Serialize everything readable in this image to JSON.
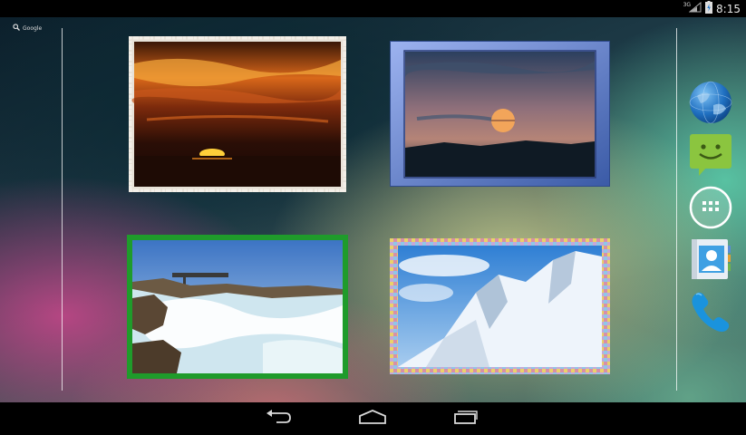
{
  "status_bar": {
    "network_label": "3G",
    "time": "8:15",
    "icons": [
      "signal-icon",
      "battery-icon"
    ]
  },
  "search": {
    "label": "Google",
    "icon": "search-icon"
  },
  "dock": {
    "items": [
      {
        "name": "browser",
        "icon": "globe-icon"
      },
      {
        "name": "messaging",
        "icon": "message-smiley-icon"
      },
      {
        "name": "all-apps",
        "icon": "app-drawer-icon"
      },
      {
        "name": "people",
        "icon": "contacts-icon"
      },
      {
        "name": "phone",
        "icon": "phone-icon"
      }
    ]
  },
  "widgets": [
    {
      "subject": "sunset-over-sea",
      "frame": "grunge-white"
    },
    {
      "subject": "moonrise-over-lake",
      "frame": "blue-bevel"
    },
    {
      "subject": "waves-on-rocks",
      "frame": "green"
    },
    {
      "subject": "snowy-mountain",
      "frame": "colored-mosaic"
    }
  ],
  "nav_bar": {
    "items": [
      "back-icon",
      "home-icon",
      "recents-icon"
    ]
  },
  "colors": {
    "status_bar": "#000000",
    "nav_bar": "#000000",
    "green_frame": "#1f9b2b",
    "blue_frame": "#5b7ac6",
    "sms_green": "#8bc53f",
    "phone_blue": "#1a93dd"
  }
}
